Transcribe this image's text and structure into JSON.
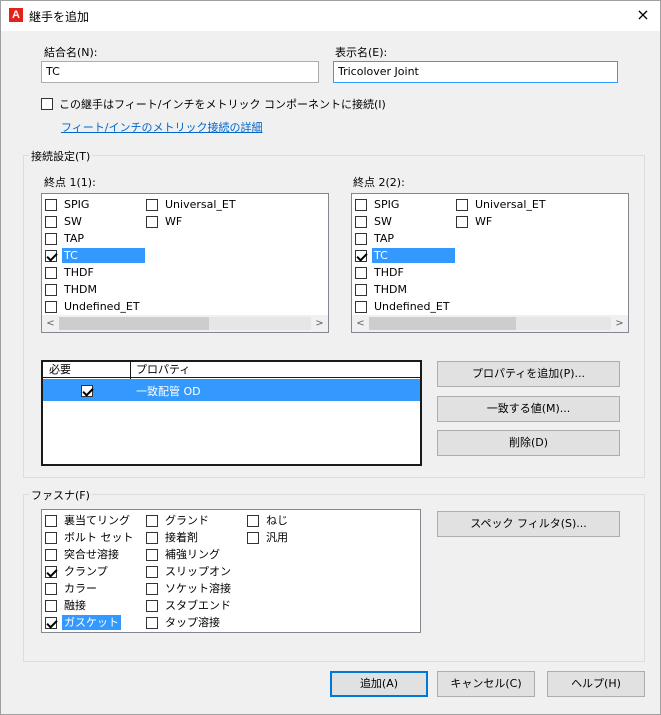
{
  "window": {
    "title": "継手を追加",
    "close_glyph": "×",
    "app_icon_letter": "A"
  },
  "fields": {
    "join_name_label": "結合名(N):",
    "join_name_value": "TC",
    "display_name_label": "表示名(E):",
    "display_name_value": "Tricolover Joint"
  },
  "metric_checkbox": {
    "label": "この継手はフィート/インチをメトリック コンポーネントに接続(I)",
    "checked": false
  },
  "metric_link": "フィート/インチのメトリック接続の詳細",
  "connection": {
    "group_label": "接続設定(T)",
    "end1_label": "終点 1(1):",
    "end2_label": "終点 2(2):",
    "end1_items": [
      {
        "label": "SPIG",
        "checked": false
      },
      {
        "label": "SW",
        "checked": false
      },
      {
        "label": "TAP",
        "checked": false
      },
      {
        "label": "TC",
        "checked": true,
        "selected": true
      },
      {
        "label": "THDF",
        "checked": false
      },
      {
        "label": "THDM",
        "checked": false
      },
      {
        "label": "Undefined_ET",
        "checked": false
      },
      {
        "label": "Universal_ET",
        "checked": false
      },
      {
        "label": "WF",
        "checked": false
      }
    ],
    "end2_items": [
      {
        "label": "SPIG",
        "checked": false
      },
      {
        "label": "SW",
        "checked": false
      },
      {
        "label": "TAP",
        "checked": false
      },
      {
        "label": "TC",
        "checked": true,
        "selected": true
      },
      {
        "label": "THDF",
        "checked": false
      },
      {
        "label": "THDM",
        "checked": false
      },
      {
        "label": "Undefined_ET",
        "checked": false
      },
      {
        "label": "Universal_ET",
        "checked": false
      },
      {
        "label": "WF",
        "checked": false
      }
    ],
    "scroll_left": "<",
    "scroll_right": ">",
    "properties_table": {
      "headers": [
        "必要",
        "プロパティ"
      ],
      "rows": [
        {
          "required": true,
          "property": "一致配管 OD"
        }
      ]
    },
    "add_property_button": "プロパティを追加(P)...",
    "match_value_button": "一致する値(M)...",
    "delete_button": "削除(D)"
  },
  "fasteners": {
    "group_label": "ファスナ(F)",
    "items": [
      {
        "label": "裏当てリング",
        "checked": false
      },
      {
        "label": "ボルト セット",
        "checked": false
      },
      {
        "label": "突合せ溶接",
        "checked": false
      },
      {
        "label": "クランプ",
        "checked": true
      },
      {
        "label": "カラー",
        "checked": false
      },
      {
        "label": "融接",
        "checked": false
      },
      {
        "label": "ガスケット",
        "checked": true,
        "selected": true
      },
      {
        "label": "グランド",
        "checked": false
      },
      {
        "label": "接着剤",
        "checked": false
      },
      {
        "label": "補強リング",
        "checked": false
      },
      {
        "label": "スリップオン",
        "checked": false
      },
      {
        "label": "ソケット溶接",
        "checked": false
      },
      {
        "label": "スタブエンド",
        "checked": false
      },
      {
        "label": "タップ溶接",
        "checked": false
      },
      {
        "label": "ねじ",
        "checked": false
      },
      {
        "label": "汎用",
        "checked": false
      }
    ],
    "spec_filter_button": "スペック フィルタ(S)..."
  },
  "footer": {
    "add_button": "追加(A)",
    "cancel_button": "キャンセル(C)",
    "help_button": "ヘルプ(H)"
  },
  "colors": {
    "selection": "#3399ff",
    "link": "#0066cc",
    "app_icon": "#e2231a"
  }
}
